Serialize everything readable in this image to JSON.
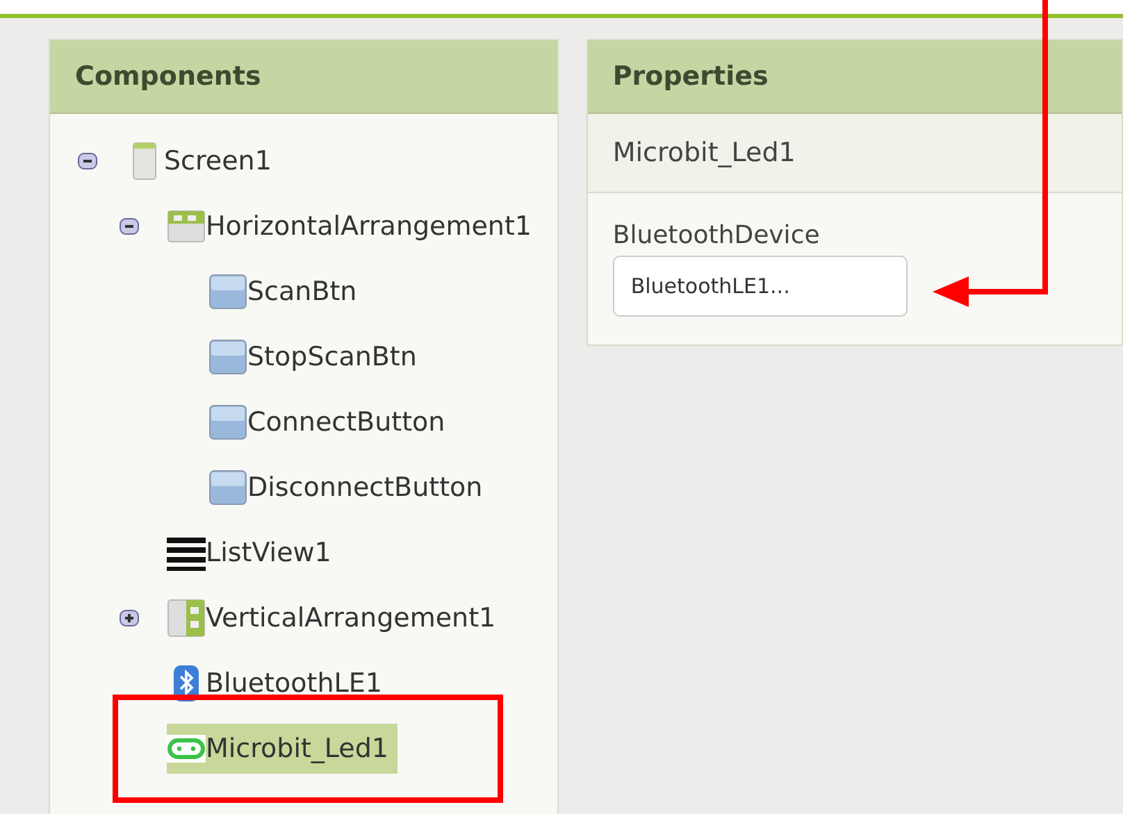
{
  "components": {
    "title": "Components",
    "tree": [
      {
        "label": "Screen1",
        "kind": "screen",
        "expanded": true,
        "selected": false,
        "children": [
          {
            "label": "HorizontalArrangement1",
            "kind": "horizontal",
            "expanded": true,
            "selected": false,
            "children": [
              {
                "label": "ScanBtn",
                "kind": "button",
                "selected": false
              },
              {
                "label": "StopScanBtn",
                "kind": "button",
                "selected": false
              },
              {
                "label": "ConnectButton",
                "kind": "button",
                "selected": false
              },
              {
                "label": "DisconnectButton",
                "kind": "button",
                "selected": false
              }
            ]
          },
          {
            "label": "ListView1",
            "kind": "listview",
            "selected": false
          },
          {
            "label": "VerticalArrangement1",
            "kind": "vertical",
            "expanded": false,
            "selected": false
          },
          {
            "label": "BluetoothLE1",
            "kind": "bluetooth",
            "selected": false
          },
          {
            "label": "Microbit_Led1",
            "kind": "microbit",
            "selected": true
          }
        ]
      }
    ]
  },
  "properties": {
    "title": "Properties",
    "component": "Microbit_Led1",
    "fields": [
      {
        "label": "BluetoothDevice",
        "value": "BluetoothLE1..."
      }
    ]
  }
}
